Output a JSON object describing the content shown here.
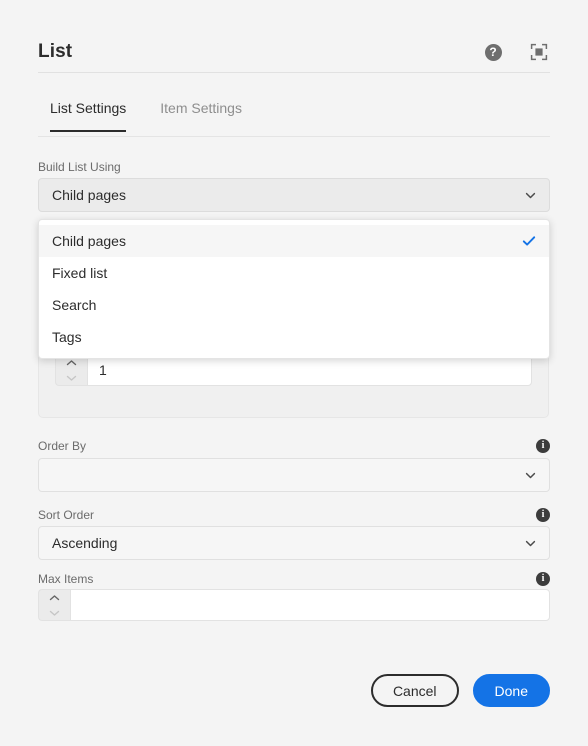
{
  "header": {
    "title": "List",
    "help_icon": "help-circle-icon",
    "help_glyph": "?",
    "fullscreen_icon": "fullscreen-icon"
  },
  "tabs": [
    {
      "label": "List Settings",
      "active": true
    },
    {
      "label": "Item Settings",
      "active": false
    }
  ],
  "fields": {
    "build_list_using": {
      "label": "Build List Using",
      "value": "Child pages",
      "options": [
        {
          "label": "Child pages",
          "selected": true
        },
        {
          "label": "Fixed list",
          "selected": false
        },
        {
          "label": "Search",
          "selected": false
        },
        {
          "label": "Tags",
          "selected": false
        }
      ]
    },
    "nested_depth": {
      "value": "1",
      "placeholder": ""
    },
    "order_by": {
      "label": "Order By",
      "value": "",
      "placeholder": "",
      "info_glyph": "i",
      "info_icon": "info-icon"
    },
    "sort_order": {
      "label": "Sort Order",
      "value": "Ascending",
      "info_glyph": "i",
      "info_icon": "info-icon"
    },
    "max_items": {
      "label": "Max Items",
      "value": "",
      "placeholder": "",
      "info_glyph": "i",
      "info_icon": "info-icon"
    }
  },
  "footer": {
    "cancel_label": "Cancel",
    "done_label": "Done"
  },
  "colors": {
    "accent_blue": "#1473e6",
    "check_blue": "#1473e6",
    "background": "#f4f4f4",
    "text_primary": "#2c2c2c",
    "text_muted": "#6b6b6b"
  }
}
